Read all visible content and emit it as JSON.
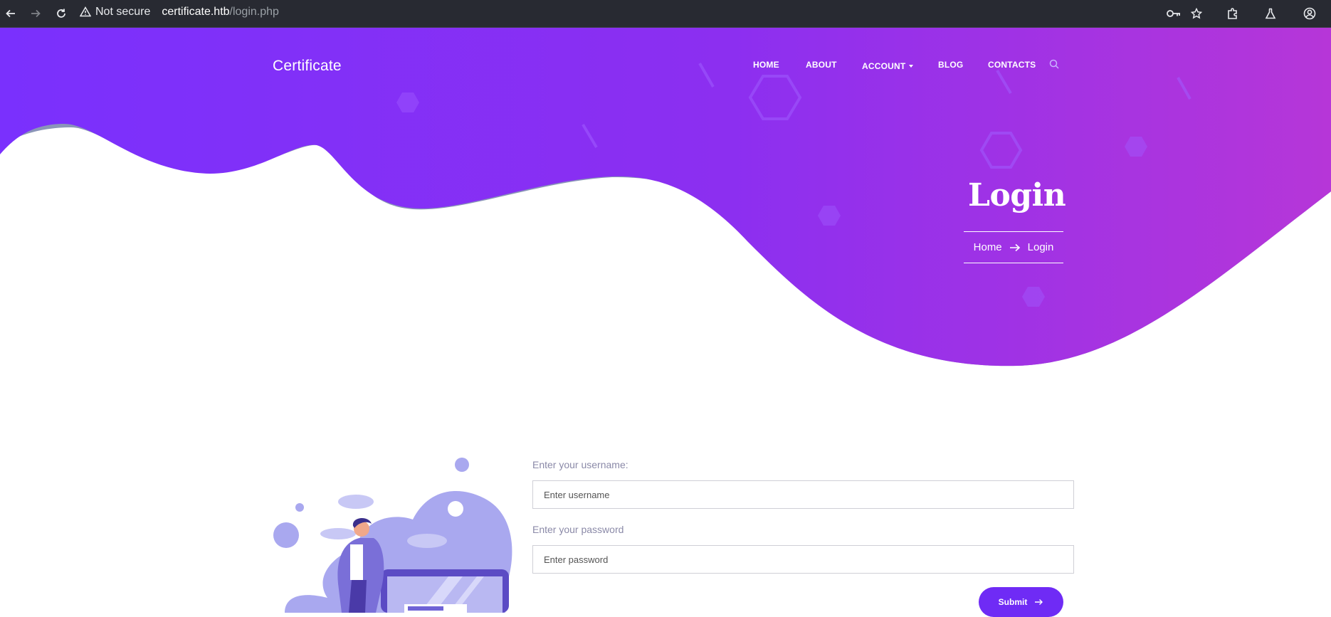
{
  "browser": {
    "security_label": "Not secure",
    "url_host": "certificate.htb",
    "url_path": "/login.php"
  },
  "site": {
    "brand": "Certificate",
    "nav": [
      {
        "label": "HOME"
      },
      {
        "label": "ABOUT"
      },
      {
        "label": "ACCOUNT"
      },
      {
        "label": "BLOG"
      },
      {
        "label": "CONTACTS"
      }
    ]
  },
  "hero": {
    "title": "Login",
    "breadcrumb_home": "Home",
    "breadcrumb_current": "Login"
  },
  "form": {
    "username_label": "Enter your username:",
    "username_placeholder": "Enter username",
    "password_label": "Enter your password",
    "password_placeholder": "Enter password",
    "submit_label": "Submit"
  },
  "colors": {
    "brand_purple": "#6f2bf5",
    "hero_gradient_start": "#7a30fc",
    "hero_gradient_end": "#b636d8"
  }
}
